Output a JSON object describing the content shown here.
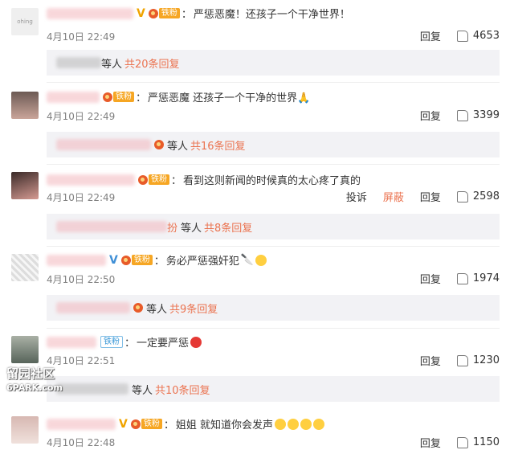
{
  "comments": [
    {
      "text": "严惩恶魔！还孩子一个干净世界！",
      "time": "4月10日 22:49",
      "reply": "回复",
      "likes": "4653",
      "sub_who": "等人",
      "sub_count": "共20条回复",
      "badge": "铁粉",
      "avatar_text": "ohing"
    },
    {
      "text": "严惩恶魔 还孩子一个干净的世界🙏",
      "time": "4月10日 22:49",
      "reply": "回复",
      "likes": "3399",
      "sub_who": "等人",
      "sub_count": "共16条回复",
      "badge": "铁粉"
    },
    {
      "text": "看到这则新闻的时候真的太心疼了真的",
      "time": "4月10日 22:49",
      "report": "投诉",
      "block": "屏蔽",
      "reply": "回复",
      "likes": "2598",
      "sub_prefix": "扮",
      "sub_who": "等人",
      "sub_count": "共8条回复",
      "badge": "铁粉"
    },
    {
      "text": "务必严惩强奸犯",
      "time": "4月10日 22:50",
      "reply": "回复",
      "likes": "1974",
      "sub_who": "等人",
      "sub_count": "共9条回复",
      "badge": "铁粉"
    },
    {
      "text": "一定要严惩",
      "time": "4月10日 22:51",
      "reply": "回复",
      "likes": "1230",
      "sub_who": "等人",
      "sub_count": "共10条回复",
      "badge": "铁粉"
    },
    {
      "text": "姐姐 就知道你会发声",
      "time": "4月10日 22:48",
      "reply": "回复",
      "likes": "1150",
      "badge": "铁粉"
    }
  ],
  "watermark": {
    "line1": "留园社区",
    "line2": "6PARK.com"
  }
}
